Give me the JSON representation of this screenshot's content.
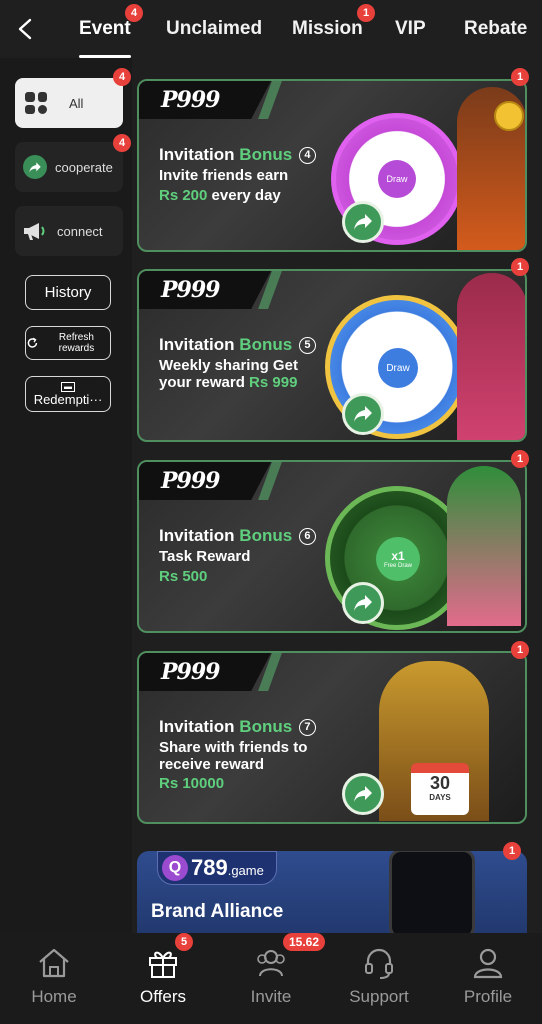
{
  "tabs": [
    {
      "label": "Event",
      "badge": "4"
    },
    {
      "label": "Unclaimed"
    },
    {
      "label": "Mission",
      "badge": "1"
    },
    {
      "label": "VIP"
    },
    {
      "label": "Rebate"
    }
  ],
  "sidebar": {
    "categories": [
      {
        "label": "All",
        "badge": "4"
      },
      {
        "label": "cooperate",
        "badge": "4"
      },
      {
        "label": "connect"
      }
    ],
    "history": "History",
    "refresh": "Refresh rewards",
    "redemption": "Redempti···"
  },
  "cards": [
    {
      "logo": "P999",
      "title_a": "Invitation",
      "title_b": "Bonus",
      "num": "4",
      "desc": "Invite friends earn",
      "reward_a": "Rs 200",
      "reward_b": " every day",
      "badge": "1",
      "wheel_text": "Draw"
    },
    {
      "logo": "P999",
      "title_a": "Invitation",
      "title_b": "Bonus",
      "num": "5",
      "desc": "Weekly sharing Get your reward",
      "reward_a": "Rs 999",
      "badge": "1",
      "wheel_text": "Draw"
    },
    {
      "logo": "P999",
      "title_a": "Invitation",
      "title_b": "Bonus",
      "num": "6",
      "desc": "Task Reward",
      "reward_a": "Rs 500",
      "badge": "1",
      "wheel_text": "x1",
      "wheel_sub": "Free Draw"
    },
    {
      "logo": "P999",
      "title_a": "Invitation",
      "title_b": "Bonus",
      "num": "7",
      "desc": "Share with friends to receive reward",
      "reward_a": "Rs 10000",
      "badge": "1",
      "calendar": "30",
      "calendar_sub": "DAYS"
    }
  ],
  "brand": {
    "logo_q": "Q",
    "logo": "789",
    "logo_suffix": ".game",
    "title": "Brand Alliance",
    "badge": "1"
  },
  "bottom_nav": [
    {
      "label": "Home"
    },
    {
      "label": "Offers",
      "badge": "5"
    },
    {
      "label": "Invite",
      "badge": "15.62"
    },
    {
      "label": "Support"
    },
    {
      "label": "Profile"
    }
  ],
  "colors": {
    "accent_green": "#5fcf7d",
    "badge_red": "#e8413b",
    "card_border": "#4f8e5e"
  }
}
